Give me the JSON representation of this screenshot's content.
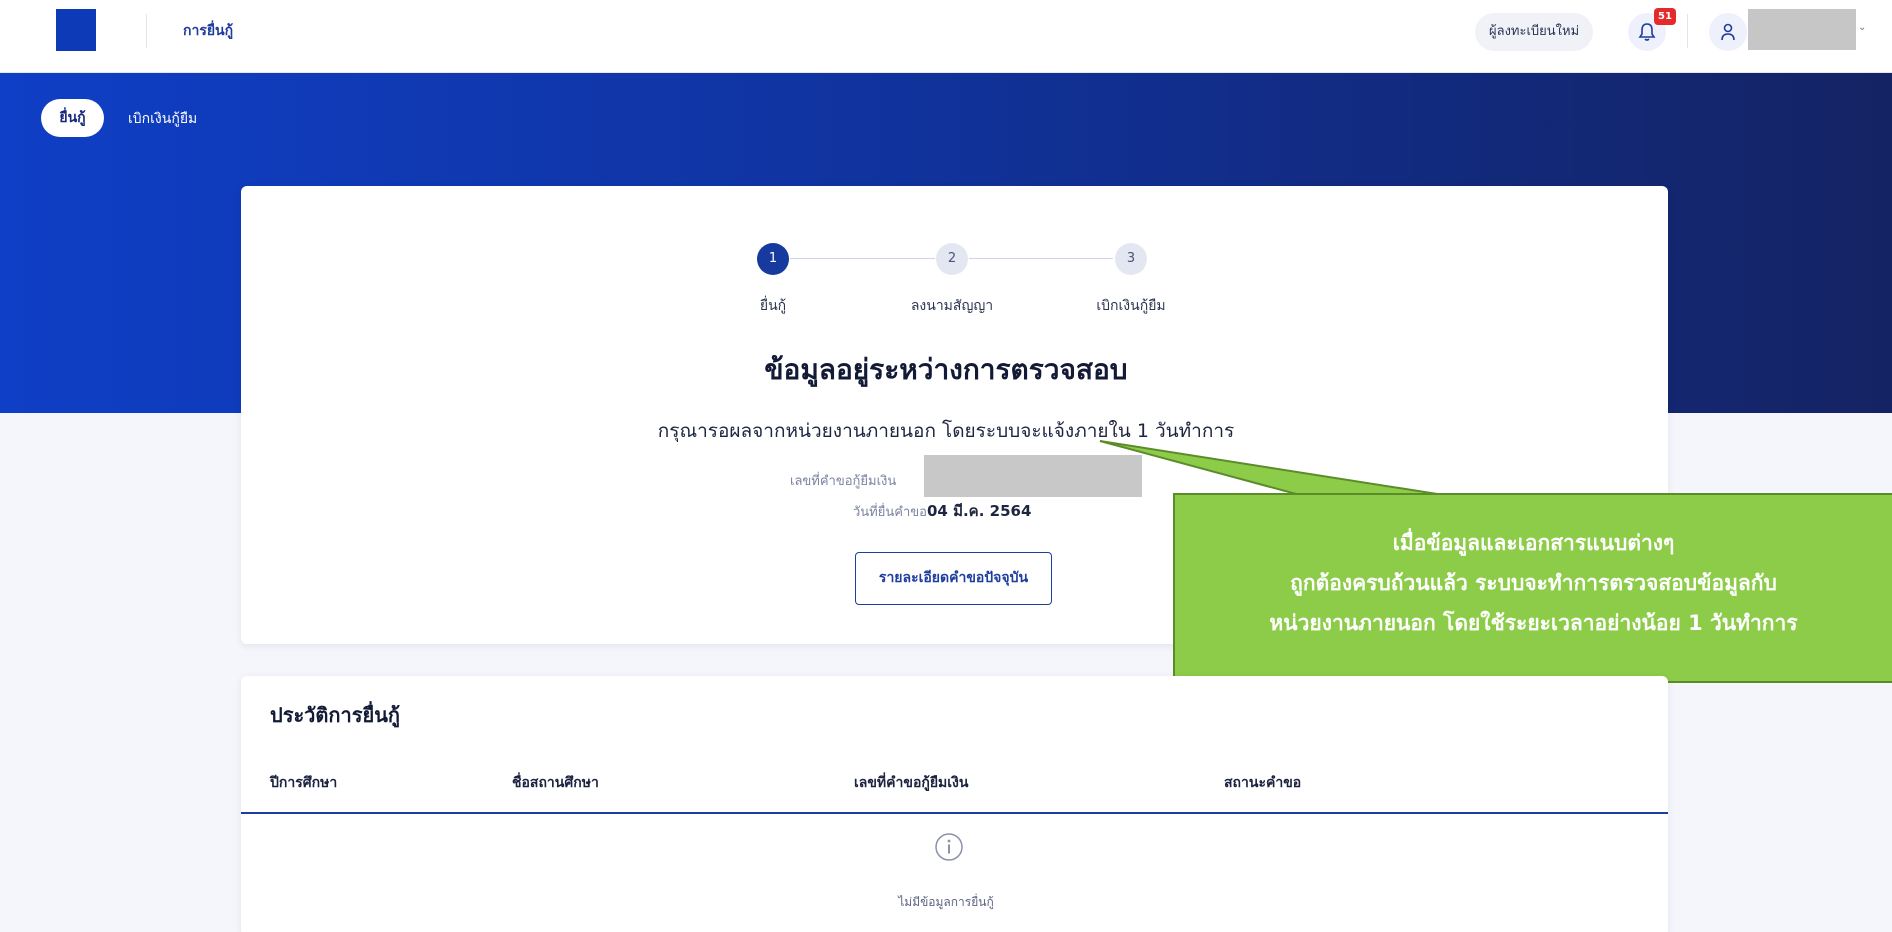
{
  "topbar": {
    "title": "การยื่นกู้",
    "new_register": "ผู้ลงทะเบียนใหม่",
    "notification_count": "51",
    "icons": {
      "bell": "bell-icon",
      "user": "user-icon",
      "chevron": "chevron-down-icon"
    }
  },
  "tabs": [
    {
      "label": "ยื่นกู้",
      "active": true
    },
    {
      "label": "เบิกเงินกู้ยืม",
      "active": false
    }
  ],
  "steps": [
    {
      "number": "1",
      "label": "ยื่นกู้",
      "active": true
    },
    {
      "number": "2",
      "label": "ลงนามสัญญา",
      "active": false
    },
    {
      "number": "3",
      "label": "เบิกเงินกู้ยืม",
      "active": false
    }
  ],
  "status": {
    "title": "ข้อมูลอยู่ระหว่างการตรวจสอบ",
    "description": "กรุณารอผลจากหน่วยงานภายนอก โดยระบบจะแจ้งภายใน 1 วันทำการ",
    "request_no_label": "เลขที่คำขอกู้ยืมเงิน",
    "request_date_label": "วันที่ยื่นคำขอ",
    "request_date": "04 มี.ค. 2564",
    "detail_button": "รายละเอียดคำขอปัจจุบัน"
  },
  "callout": {
    "line1": "เมื่อข้อมูลและเอกสารแนบต่างๆ",
    "line2": "ถูกต้องครบถ้วนแล้ว ระบบจะทำการตรวจสอบข้อมูลกับ",
    "line3": "หน่วยงานภายนอก โดยใช้ระยะเวลาอย่างน้อย 1 วันทำการ",
    "colors": {
      "fill": "#8ccc48",
      "border": "#5c8b2a"
    }
  },
  "history": {
    "title": "ประวัติการยื่นกู้",
    "columns": [
      "ปีการศึกษา",
      "ชื่อสถานศึกษา",
      "เลขที่คำขอกู้ยืมเงิน",
      "สถานะคำขอ"
    ],
    "empty_text": "ไม่มีข้อมูลการยื่นกู้"
  },
  "colors": {
    "brand": "#0d3bb8",
    "accent": "#163a9e",
    "badge": "#e32b2b"
  }
}
